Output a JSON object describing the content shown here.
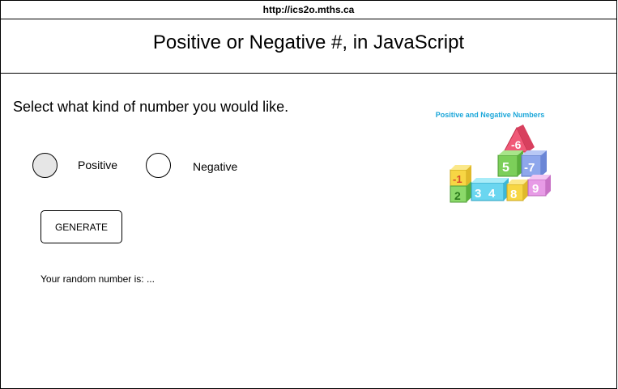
{
  "browser": {
    "url": "http://ics2o.mths.ca"
  },
  "header": {
    "title": "Positive or Negative #, in JavaScript"
  },
  "main": {
    "prompt": "Select what kind of number you would like.",
    "options": [
      {
        "label": "Positive",
        "selected": true
      },
      {
        "label": "Negative",
        "selected": false
      }
    ],
    "generate_label": "GENERATE",
    "result_text": "Your random number is: ..."
  },
  "illustration": {
    "title": "Positive and Negative Numbers",
    "blocks": [
      "-6",
      "5",
      "-7",
      "-1",
      "2",
      "3",
      "4",
      "8",
      "9"
    ]
  }
}
